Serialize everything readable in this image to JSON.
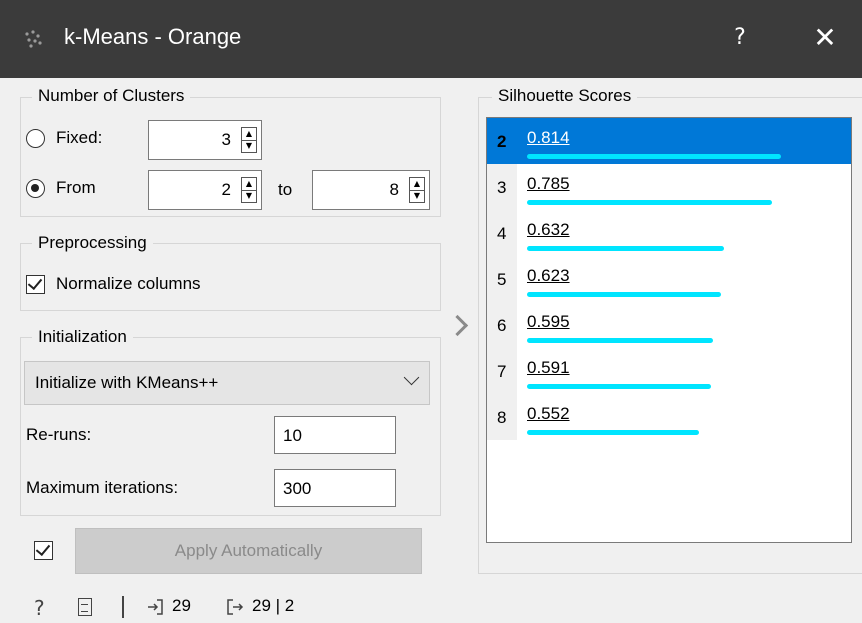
{
  "window": {
    "title": "k-Means - Orange",
    "help": "?",
    "close": "✕"
  },
  "clusters": {
    "title": "Number of Clusters",
    "fixed_label": "Fixed:",
    "fixed_value": "3",
    "fixed_checked": false,
    "from_label": "From",
    "from_value": "2",
    "from_checked": true,
    "to_label": "to",
    "to_value": "8"
  },
  "preprocessing": {
    "title": "Preprocessing",
    "normalize_label": "Normalize columns",
    "normalize_checked": true
  },
  "initialization": {
    "title": "Initialization",
    "method": "Initialize with KMeans++",
    "reruns_label": "Re-runs:",
    "reruns_value": "10",
    "maxiter_label": "Maximum iterations:",
    "maxiter_value": "300"
  },
  "apply": {
    "auto_checked": true,
    "label": "Apply Automatically"
  },
  "silhouette": {
    "title": "Silhouette Scores",
    "selected_k": "2",
    "rows": [
      {
        "k": "2",
        "score": "0.814",
        "value": 0.814
      },
      {
        "k": "3",
        "score": "0.785",
        "value": 0.785
      },
      {
        "k": "4",
        "score": "0.632",
        "value": 0.632
      },
      {
        "k": "5",
        "score": "0.623",
        "value": 0.623
      },
      {
        "k": "6",
        "score": "0.595",
        "value": 0.595
      },
      {
        "k": "7",
        "score": "0.591",
        "value": 0.591
      },
      {
        "k": "8",
        "score": "0.552",
        "value": 0.552
      }
    ],
    "bar_color": "#00e5ff",
    "selection_color": "#0078d7"
  },
  "status": {
    "input_count": "29",
    "output_count": "29 | 2"
  }
}
